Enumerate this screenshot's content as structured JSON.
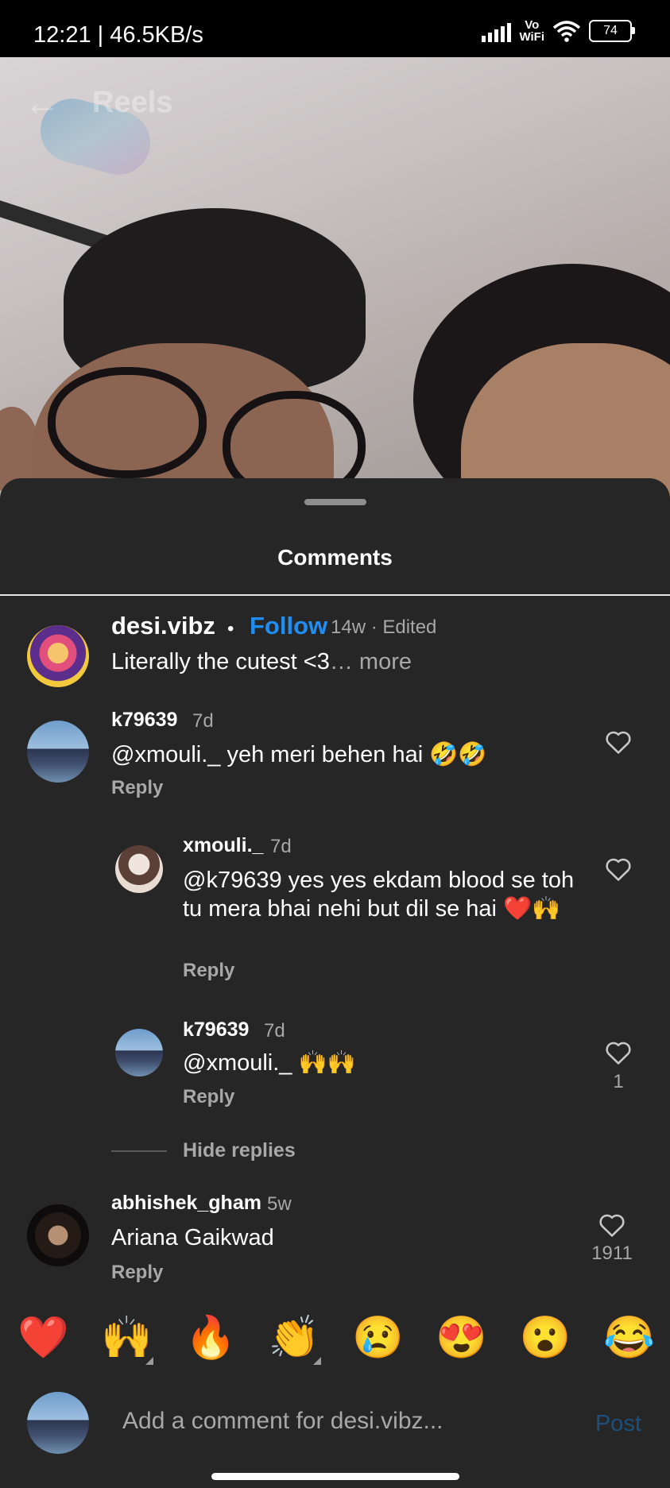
{
  "status_bar": {
    "time": "12:21 | 46.5KB/s",
    "network": "Vo\nWiFi",
    "battery": "74"
  },
  "reel": {
    "back_icon": "back-arrow-icon",
    "title": "Reels"
  },
  "sheet": {
    "title": "Comments"
  },
  "caption": {
    "username": "desi.vibz",
    "separator": "•",
    "follow_label": "Follow",
    "meta": "14w · Edited",
    "text": "Literally the cutest <3",
    "more": "… more"
  },
  "comments": [
    {
      "username": "k79639",
      "time": "7d",
      "text": "@xmouli._ yeh meri behen hai 🤣🤣",
      "reply_label": "Reply",
      "likes": ""
    },
    {
      "username": "xmouli._",
      "time": "7d",
      "text": "@k79639 yes yes ekdam blood se toh tu mera bhai nehi but dil se hai ❤️🙌",
      "reply_label": "Reply",
      "likes": ""
    },
    {
      "username": "k79639",
      "time": "7d",
      "text": "@xmouli._ 🙌🙌",
      "reply_label": "Reply",
      "likes": "1"
    },
    {
      "username": "abhishek_gham",
      "time": "5w",
      "text": "Ariana Gaikwad",
      "reply_label": "Reply",
      "likes": "1911"
    }
  ],
  "hide_replies_label": "Hide replies",
  "quick_reactions": [
    "❤️",
    "🙌",
    "🔥",
    "👏",
    "😢",
    "😍",
    "😮",
    "😂"
  ],
  "composer": {
    "placeholder": "Add a comment for desi.vibz...",
    "post_label": "Post"
  },
  "colors": {
    "sheet_bg": "#262626",
    "accent": "#1f8df2",
    "secondary_text": "#a8a8a8"
  }
}
